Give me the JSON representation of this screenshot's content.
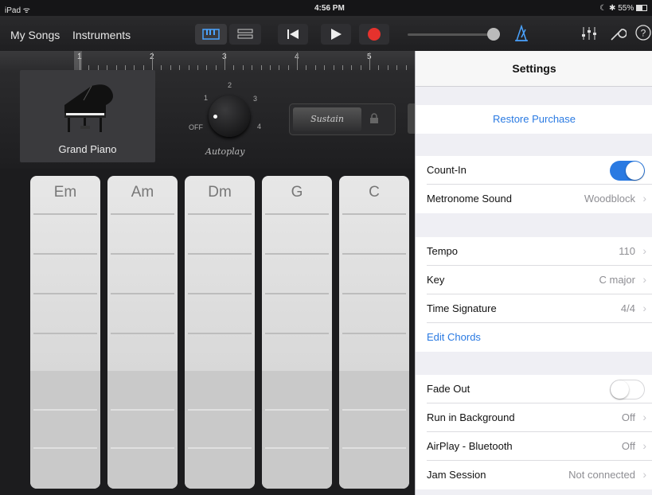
{
  "status": {
    "device": "iPad",
    "time": "4:56 PM",
    "battery": "55%"
  },
  "toolbar": {
    "my_songs": "My Songs",
    "instruments": "Instruments"
  },
  "ruler": {
    "bars": [
      "1",
      "2",
      "3",
      "4",
      "5"
    ]
  },
  "instrument": {
    "name": "Grand Piano"
  },
  "autoplay": {
    "label": "Autoplay",
    "off": "OFF",
    "n1": "1",
    "n2": "2",
    "n3": "3",
    "n4": "4"
  },
  "sustain": {
    "label": "Sustain"
  },
  "chords": [
    "Em",
    "Am",
    "Dm",
    "G",
    "C"
  ],
  "settings": {
    "title": "Settings",
    "restore": "Restore Purchase",
    "count_in": "Count-In",
    "metronome": {
      "label": "Metronome Sound",
      "value": "Woodblock"
    },
    "tempo": {
      "label": "Tempo",
      "value": "110"
    },
    "key": {
      "label": "Key",
      "value": "C major"
    },
    "time_sig": {
      "label": "Time Signature",
      "value": "4/4"
    },
    "edit_chords": "Edit Chords",
    "fade_out": "Fade Out",
    "run_bg": {
      "label": "Run in Background",
      "value": "Off"
    },
    "airplay": {
      "label": "AirPlay - Bluetooth",
      "value": "Off"
    },
    "jam": {
      "label": "Jam Session",
      "value": "Not connected"
    }
  },
  "colors": {
    "accent": "#2a7ae2",
    "record": "#e5322d"
  }
}
